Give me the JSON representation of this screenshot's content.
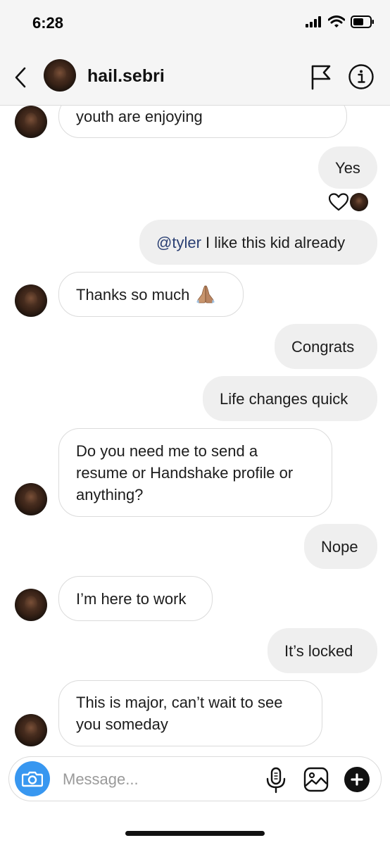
{
  "status_bar": {
    "time": "6:28",
    "icons": [
      "cellular-signal-icon",
      "wifi-icon",
      "battery-icon"
    ]
  },
  "header": {
    "username": "hail.sebri",
    "icons": [
      "back-chevron-icon",
      "flag-icon",
      "info-icon"
    ]
  },
  "messages": [
    {
      "direction": "incoming",
      "text": "youth are enjoying"
    },
    {
      "direction": "outgoing",
      "text": "Yes",
      "reactions": [
        "heart-icon",
        "reactor-avatar"
      ]
    },
    {
      "direction": "outgoing",
      "mention": "@tyler",
      "text": " I like this kid already"
    },
    {
      "direction": "incoming",
      "text": "Thanks so much",
      "emoji": "folded-hands-emoji"
    },
    {
      "direction": "outgoing",
      "text": "Congrats"
    },
    {
      "direction": "outgoing",
      "text": "Life changes quick"
    },
    {
      "direction": "incoming",
      "lines": [
        "Do you need me to send a",
        "resume or Handshake profile or",
        "anything?"
      ]
    },
    {
      "direction": "outgoing",
      "text": "Nope"
    },
    {
      "direction": "incoming",
      "text": "I’m here to work"
    },
    {
      "direction": "outgoing",
      "text": "It’s locked"
    },
    {
      "direction": "incoming",
      "lines": [
        "This is major, can’t wait to see",
        "you someday"
      ]
    }
  ],
  "composer": {
    "placeholder": "Message...",
    "icons": [
      "camera-icon",
      "microphone-icon",
      "gallery-icon",
      "plus-icon"
    ]
  },
  "colors": {
    "incoming_bubble": "#ffffff",
    "outgoing_bubble": "#efefef",
    "mention": "#2a3f73",
    "camera_button": "#3897f0"
  }
}
